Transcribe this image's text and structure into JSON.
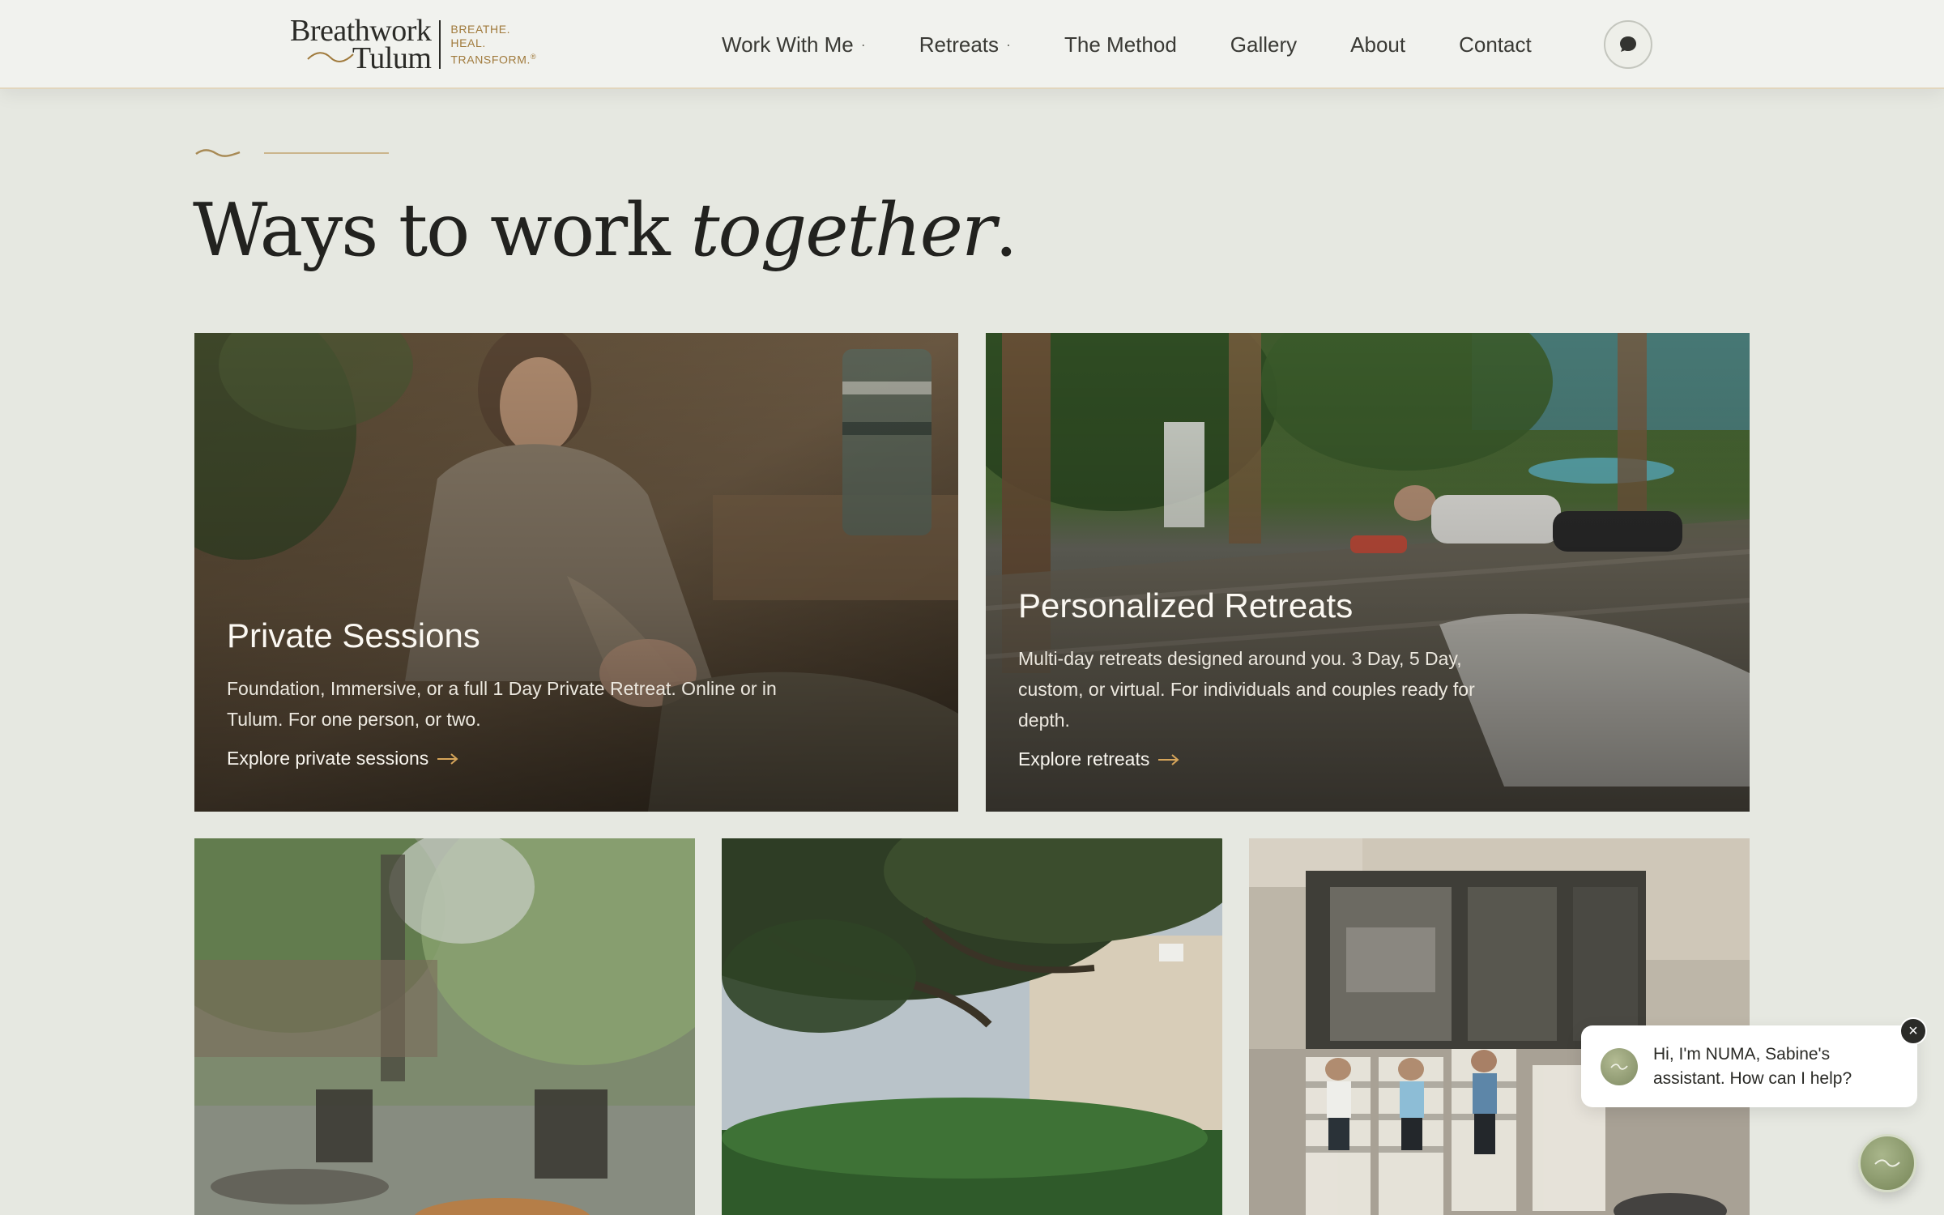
{
  "brand": {
    "name_line1": "Breathwork",
    "name_line2": "Tulum",
    "tagline": [
      "BREATHE.",
      "HEAL.",
      "TRANSFORM."
    ],
    "registered": "®"
  },
  "nav": {
    "items": [
      {
        "label": "Work With Me",
        "has_dropdown": true
      },
      {
        "label": "Retreats",
        "has_dropdown": true
      },
      {
        "label": "The Method",
        "has_dropdown": false
      },
      {
        "label": "Gallery",
        "has_dropdown": false
      },
      {
        "label": "About",
        "has_dropdown": false
      },
      {
        "label": "Contact",
        "has_dropdown": false
      }
    ],
    "dropdown_marker": "·",
    "chat_icon": "chat-bubble-icon"
  },
  "section": {
    "title_plain": "Ways to work ",
    "title_italic": "together",
    "title_end": "."
  },
  "cards": [
    {
      "title": "Private Sessions",
      "description": "Foundation, Immersive, or a full 1 Day Private Retreat. Online or in Tulum. For one person, or two.",
      "link": "Explore private sessions"
    },
    {
      "title": "Personalized Retreats",
      "description": "Multi-day retreats designed around you. 3 Day, 5 Day, custom, or virtual. For individuals and couples ready for depth.",
      "link": "Explore retreats"
    }
  ],
  "assistant": {
    "message": "Hi, I'm NUMA, Sabine's assistant. How can I help?",
    "close_label": "×"
  },
  "colors": {
    "background": "#e6e8e1",
    "header": "#f1f2ee",
    "accent_gold": "#a07a3c",
    "text_dark": "#2b2b27",
    "assistant_green": "#8a9870"
  }
}
